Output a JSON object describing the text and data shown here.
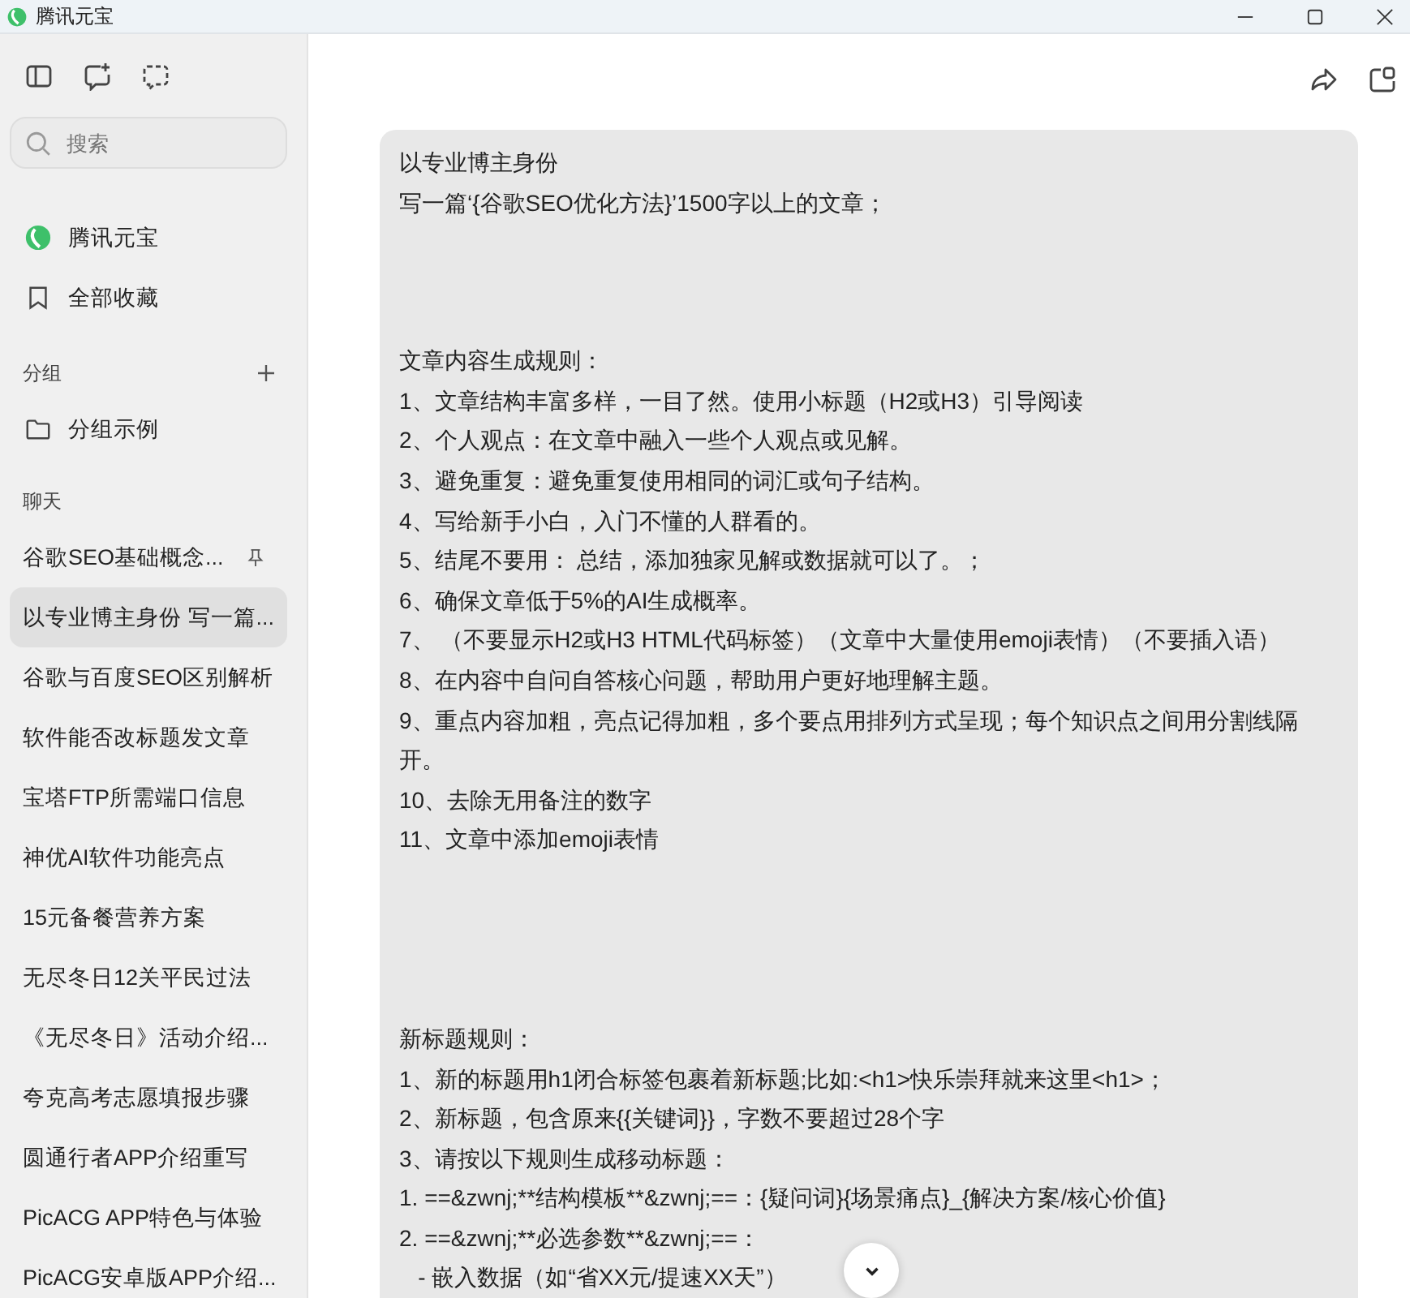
{
  "window": {
    "title": "腾讯元宝"
  },
  "sidebar": {
    "search": {
      "placeholder": "搜索"
    },
    "nav_items": [
      {
        "label": "腾讯元宝",
        "kind": "logo"
      },
      {
        "label": "全部收藏",
        "kind": "bookmark"
      }
    ],
    "groups_header": "分组",
    "groups": [
      {
        "label": "分组示例"
      }
    ],
    "chats_header": "聊天",
    "chats": [
      {
        "label": "谷歌SEO基础概念...",
        "selected": false,
        "pinned": true
      },
      {
        "label": "以专业博主身份 写一篇...",
        "selected": true,
        "pinned": false
      },
      {
        "label": "谷歌与百度SEO区别解析",
        "selected": false,
        "pinned": false
      },
      {
        "label": "软件能否改标题发文章",
        "selected": false,
        "pinned": false
      },
      {
        "label": "宝塔FTP所需端口信息",
        "selected": false,
        "pinned": false
      },
      {
        "label": "神优AI软件功能亮点",
        "selected": false,
        "pinned": false
      },
      {
        "label": "15元备餐营养方案",
        "selected": false,
        "pinned": false
      },
      {
        "label": "无尽冬日12关平民过法",
        "selected": false,
        "pinned": false
      },
      {
        "label": "《无尽冬日》活动介绍...",
        "selected": false,
        "pinned": false
      },
      {
        "label": "夸克高考志愿填报步骤",
        "selected": false,
        "pinned": false
      },
      {
        "label": "圆通行者APP介绍重写",
        "selected": false,
        "pinned": false
      },
      {
        "label": "PicACG APP特色与体验",
        "selected": false,
        "pinned": false
      },
      {
        "label": "PicACG安卓版APP介绍...",
        "selected": false,
        "pinned": false
      }
    ]
  },
  "message": {
    "blocks": [
      {
        "lines": [
          "以专业博主身份",
          "写一篇‘{谷歌SEO优化方法}’1500字以上的文章；"
        ]
      },
      {
        "lines": [
          "文章内容生成规则：",
          "1、文章结构丰富多样，一目了然。使用小标题（H2或H3）引导阅读",
          "2、个人观点：在文章中融入一些个人观点或见解。",
          "3、避免重复：避免重复使用相同的词汇或句子结构。",
          "4、写给新手小白，入门不懂的人群看的。",
          "5、结尾不要用： 总结，添加独家见解或数据就可以了。；",
          "6、确保文章低于5%的AI生成概率。",
          "7、 （不要显示H2或H3 HTML代码标签）（文章中大量使用emoji表情）（不要插入语）",
          "8、在内容中自问自答核心问题，帮助用户更好地理解主题。",
          "9、重点内容加粗，亮点记得加粗，多个要点用排列方式呈现；每个知识点之间用分割线隔开。",
          "10、去除无用备注的数字",
          "11、文章中添加emoji表情"
        ]
      },
      {
        "lines": [
          "新标题规则：",
          "1、新的标题用h1闭合标签包裹着新标题;比如:<h1>快乐崇拜就来这里<h1>；",
          "2、新标题，包含原来{{关键词}}，字数不要超过28个字",
          "3、请按以下规则生成移动标题：",
          "1. ==&zwnj;**结构模板**&zwnj;==：{疑问词}{场景痛点}_{解决方案/核心价值}",
          "2. ==&zwnj;**必选参数**&zwnj;==：",
          "   - 嵌入数据（如“省XX元/提速XX天”）"
        ]
      }
    ]
  }
}
